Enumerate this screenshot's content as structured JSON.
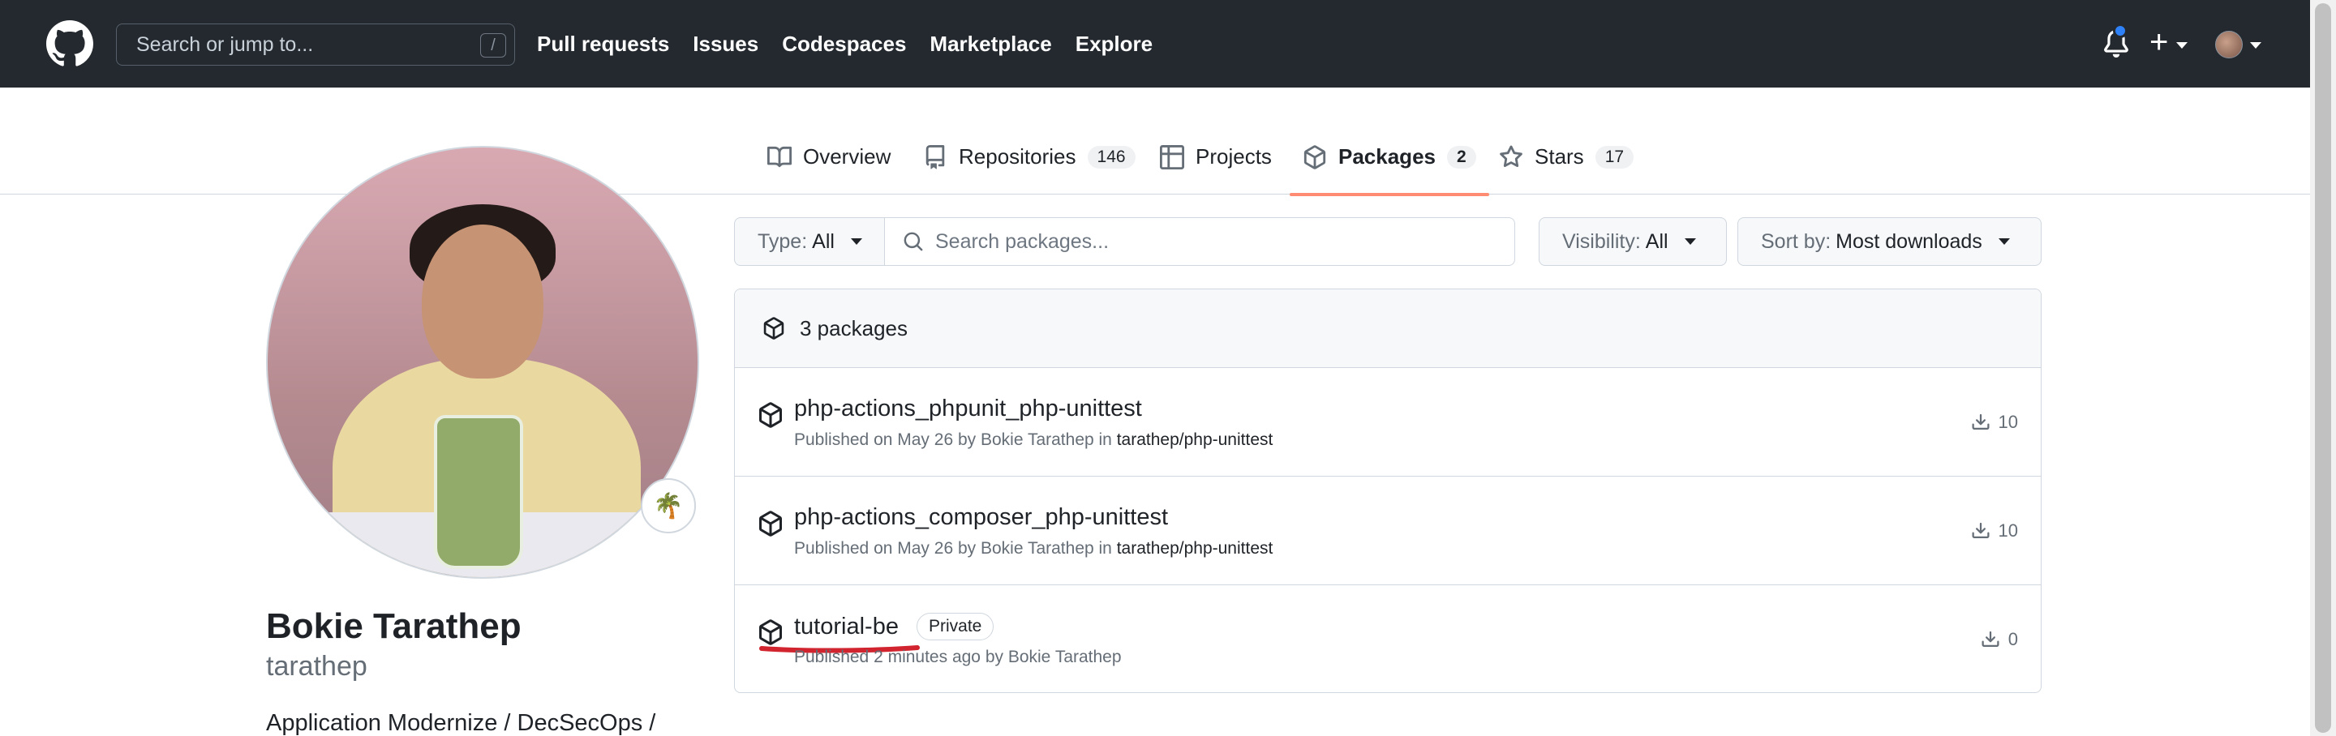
{
  "header": {
    "search_placeholder": "Search or jump to...",
    "search_shortcut": "/",
    "nav": [
      "Pull requests",
      "Issues",
      "Codespaces",
      "Marketplace",
      "Explore"
    ]
  },
  "tabs": [
    {
      "label": "Overview",
      "icon": "book-icon",
      "count": ""
    },
    {
      "label": "Repositories",
      "icon": "repo-icon",
      "count": "146"
    },
    {
      "label": "Projects",
      "icon": "table-icon",
      "count": ""
    },
    {
      "label": "Packages",
      "icon": "package-icon",
      "count": "2",
      "active": true
    },
    {
      "label": "Stars",
      "icon": "star-icon",
      "count": "17"
    }
  ],
  "profile": {
    "name": "Bokie Tarathep",
    "login": "tarathep",
    "bio": "Application Modernize / DecSecOps /",
    "status_emoji": "🌴"
  },
  "filters": {
    "type_label": "Type:",
    "type_value": "All",
    "search_placeholder": "Search packages...",
    "visibility_label": "Visibility:",
    "visibility_value": "All",
    "sort_label": "Sort by:",
    "sort_value": "Most downloads"
  },
  "packages": {
    "summary": "3 packages",
    "items": [
      {
        "name": "php-actions_phpunit_php-unittest",
        "meta_prefix": "Published on May 26 by Bokie Tarathep in ",
        "repo": "tarathep/php-unittest",
        "downloads": "10",
        "badge": ""
      },
      {
        "name": "php-actions_composer_php-unittest",
        "meta_prefix": "Published on May 26 by Bokie Tarathep in ",
        "repo": "tarathep/php-unittest",
        "downloads": "10",
        "badge": ""
      },
      {
        "name": "tutorial-be",
        "meta_prefix": "Published 2 minutes ago by Bokie Tarathep",
        "repo": "",
        "downloads": "0",
        "badge": "Private"
      }
    ]
  },
  "colors": {
    "header_bg": "#24292f",
    "active_tab_underline": "#fd8c73",
    "notification_dot": "#2f81f7",
    "annotation_red": "#d1242f"
  }
}
